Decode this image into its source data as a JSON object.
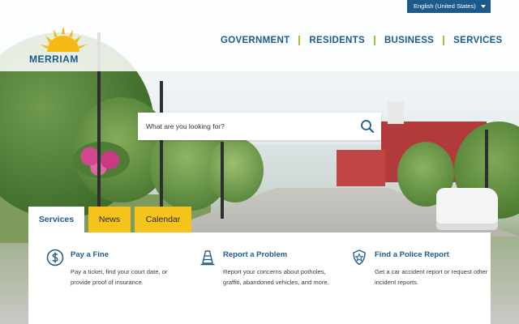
{
  "language": {
    "selected": "English (United States)"
  },
  "logo": {
    "text": "MERRIAM"
  },
  "nav": {
    "items": [
      {
        "label": "GOVERNMENT"
      },
      {
        "label": "RESIDENTS"
      },
      {
        "label": "BUSINESS"
      },
      {
        "label": "SERVICES"
      }
    ]
  },
  "search": {
    "placeholder": "What are you looking for?",
    "icon": "search-icon"
  },
  "tabs": [
    {
      "label": "Services",
      "active": true
    },
    {
      "label": "News",
      "active": false
    },
    {
      "label": "Calendar",
      "active": false
    }
  ],
  "cards": [
    {
      "title": "Pay a Fine",
      "description": "Pay a ticket, find your court date, or provide proof of insurance.",
      "icon": "dollar-circle-icon"
    },
    {
      "title": "Report a Problem",
      "description": "Report your concerns about potholes, graffiti, abandoned vehicles, and more.",
      "icon": "traffic-cone-icon"
    },
    {
      "title": "Find a Police Report",
      "description": "Get a car accident report or request other incident reports.",
      "icon": "police-badge-icon"
    }
  ],
  "colors": {
    "brand_blue": "#1c5a8c",
    "accent_green": "#a6c23a",
    "tab_yellow": "#f6c21c",
    "logo_sun": "#f5b914"
  }
}
